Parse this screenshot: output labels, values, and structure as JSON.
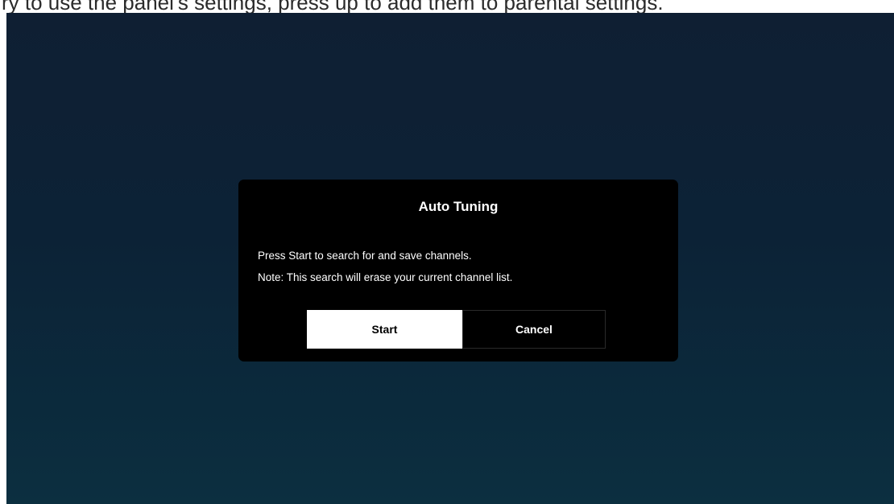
{
  "top_caption": "ry to use the panel's settings, press up to add them to parental settings.",
  "dialog": {
    "title": "Auto Tuning",
    "message_line1": "Press Start to search for and save channels.",
    "message_line2": "Note: This search will erase your current channel list.",
    "start_label": "Start",
    "cancel_label": "Cancel",
    "focused_button": "Start"
  },
  "colors": {
    "screen_background_top": "#0f1f33",
    "screen_background_bottom": "#0c2f40",
    "dialog_background": "#000000",
    "focused_button_background": "#ffffff",
    "text_light": "#ffffff"
  }
}
